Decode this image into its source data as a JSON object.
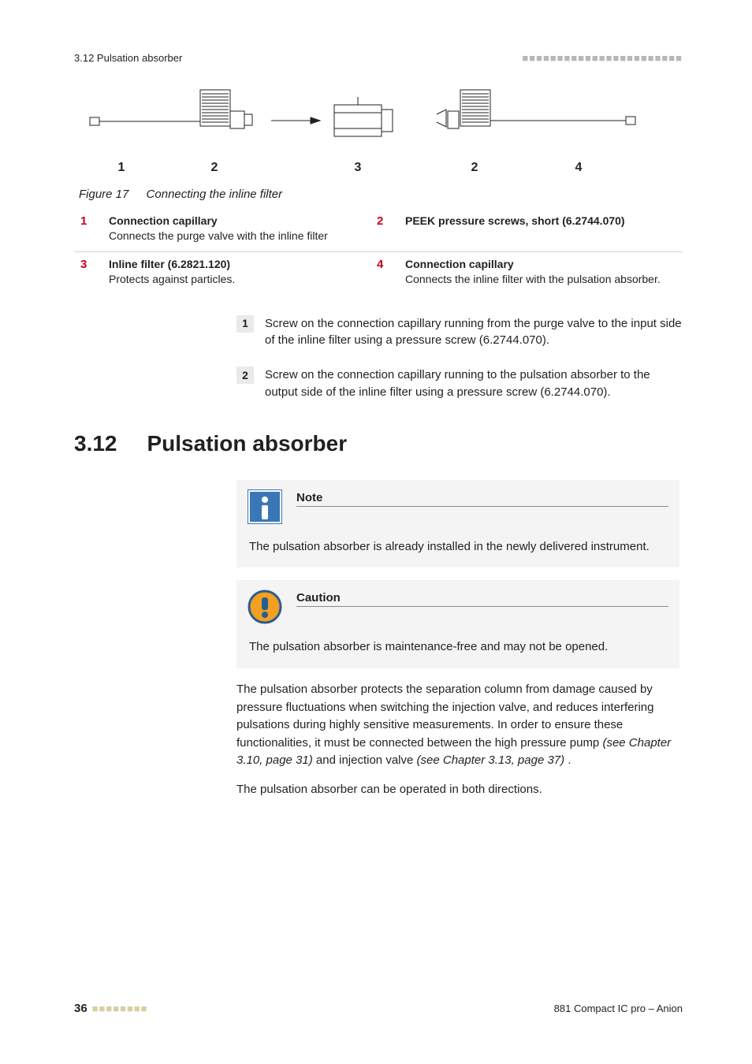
{
  "header": {
    "section_ref": "3.12 Pulsation absorber",
    "bars": "■■■■■■■■■■■■■■■■■■■■■■■"
  },
  "figure": {
    "label_prefix": "Figure 17",
    "caption": "Connecting the inline filter",
    "callouts": {
      "c1": "1",
      "c2a": "2",
      "c3": "3",
      "c2b": "2",
      "c4": "4"
    }
  },
  "legend": {
    "r1": {
      "n1": "1",
      "t1": "Connection capillary",
      "d1": "Connects the purge valve with the inline filter",
      "n2": "2",
      "t2": "PEEK pressure screws, short (6.2744.070)",
      "d2": ""
    },
    "r2": {
      "n3": "3",
      "t3": "Inline filter (6.2821.120)",
      "d3": "Protects against particles.",
      "n4": "4",
      "t4": "Connection capillary",
      "d4": "Connects the inline filter with the pulsation absorber."
    }
  },
  "steps": {
    "s1": {
      "n": "1",
      "text": "Screw on the connection capillary running from the purge valve to the input side of the inline filter using a pressure screw (6.2744.070)."
    },
    "s2": {
      "n": "2",
      "text": "Screw on the connection capillary running to the pulsation absorber to the output side of the inline filter using a pressure screw (6.2744.070)."
    }
  },
  "section": {
    "num": "3.12",
    "title": "Pulsation absorber"
  },
  "note": {
    "title": "Note",
    "body": "The pulsation absorber is already installed in the newly delivered instrument."
  },
  "caution": {
    "title": "Caution",
    "body": "The pulsation absorber is maintenance-free and may not be opened."
  },
  "para1": {
    "a": "The pulsation absorber protects the separation column from damage caused by pressure fluctuations when switching the injection valve, and reduces interfering pulsations during highly sensitive measurements. In order to ensure these functionalities, it must be connected between the high pressure pump ",
    "b": "(see Chapter 3.10, page 31)",
    "c": " and injection valve ",
    "d": "(see Chapter 3.13, page 37)",
    "e": "."
  },
  "para2": "The pulsation absorber can be operated in both directions.",
  "footer": {
    "page": "36",
    "dots": "■■■■■■■■",
    "doc": "881 Compact IC pro – Anion"
  }
}
